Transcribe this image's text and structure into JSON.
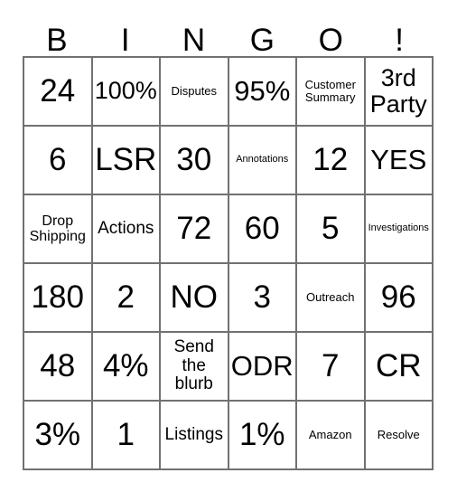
{
  "card": {
    "title": "BINGO",
    "header": {
      "letters": [
        "B",
        "I",
        "N",
        "G",
        "O",
        "!"
      ]
    },
    "colors": {
      "border": "#717171",
      "text": "#000000",
      "background": "#ffffff"
    },
    "grid": {
      "columns": 6,
      "rows": 6,
      "cells": [
        {
          "text": "24",
          "size": "s-xxl"
        },
        {
          "text": "100%",
          "size": "s-lg"
        },
        {
          "text": "Disputes",
          "size": "s-xs"
        },
        {
          "text": "95%",
          "size": "s-xl"
        },
        {
          "text": "Customer\nSummary",
          "size": "s-xs"
        },
        {
          "text": "3rd\nParty",
          "size": "s-lg"
        },
        {
          "text": "6",
          "size": "s-xxl"
        },
        {
          "text": "LSR",
          "size": "s-xxl"
        },
        {
          "text": "30",
          "size": "s-xxl"
        },
        {
          "text": "Annotations",
          "size": "s-xxs"
        },
        {
          "text": "12",
          "size": "s-xxl"
        },
        {
          "text": "YES",
          "size": "s-xl"
        },
        {
          "text": "Drop\nShipping",
          "size": "s-sm"
        },
        {
          "text": "Actions",
          "size": "s-md"
        },
        {
          "text": "72",
          "size": "s-xxl"
        },
        {
          "text": "60",
          "size": "s-xxl"
        },
        {
          "text": "5",
          "size": "s-xxl"
        },
        {
          "text": "Investigations",
          "size": "s-xxs"
        },
        {
          "text": "180",
          "size": "s-xxl"
        },
        {
          "text": "2",
          "size": "s-xxl"
        },
        {
          "text": "NO",
          "size": "s-xxl"
        },
        {
          "text": "3",
          "size": "s-xxl"
        },
        {
          "text": "Outreach",
          "size": "s-xs"
        },
        {
          "text": "96",
          "size": "s-xxl"
        },
        {
          "text": "48",
          "size": "s-xxl"
        },
        {
          "text": "4%",
          "size": "s-xxl"
        },
        {
          "text": "Send\nthe\nblurb",
          "size": "s-md"
        },
        {
          "text": "ODR",
          "size": "s-xl"
        },
        {
          "text": "7",
          "size": "s-xxl"
        },
        {
          "text": "CR",
          "size": "s-xxl"
        },
        {
          "text": "3%",
          "size": "s-xxl"
        },
        {
          "text": "1",
          "size": "s-xxl"
        },
        {
          "text": "Listings",
          "size": "s-md"
        },
        {
          "text": "1%",
          "size": "s-xxl"
        },
        {
          "text": "Amazon",
          "size": "s-xs"
        },
        {
          "text": "Resolve",
          "size": "s-xs"
        }
      ]
    }
  }
}
